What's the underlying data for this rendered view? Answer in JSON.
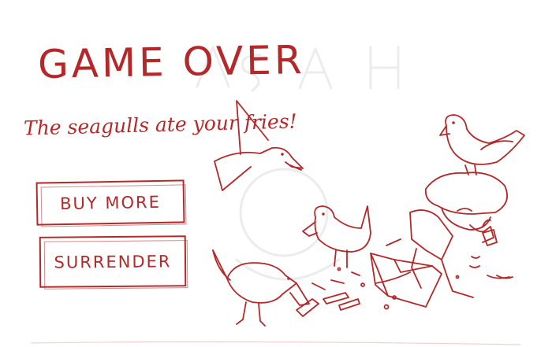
{
  "screen": {
    "title": "GAME OVER",
    "subtitle": "The seagulls ate your fries!",
    "accent_color": "#b5282a",
    "background_color": "#ffffff"
  },
  "menu": {
    "buy_more_label": "BUY MORE",
    "surrender_label": "SURRENDER"
  },
  "scene": {
    "icons": [
      "seagull-icon",
      "child-icon",
      "fries-box-icon"
    ]
  }
}
